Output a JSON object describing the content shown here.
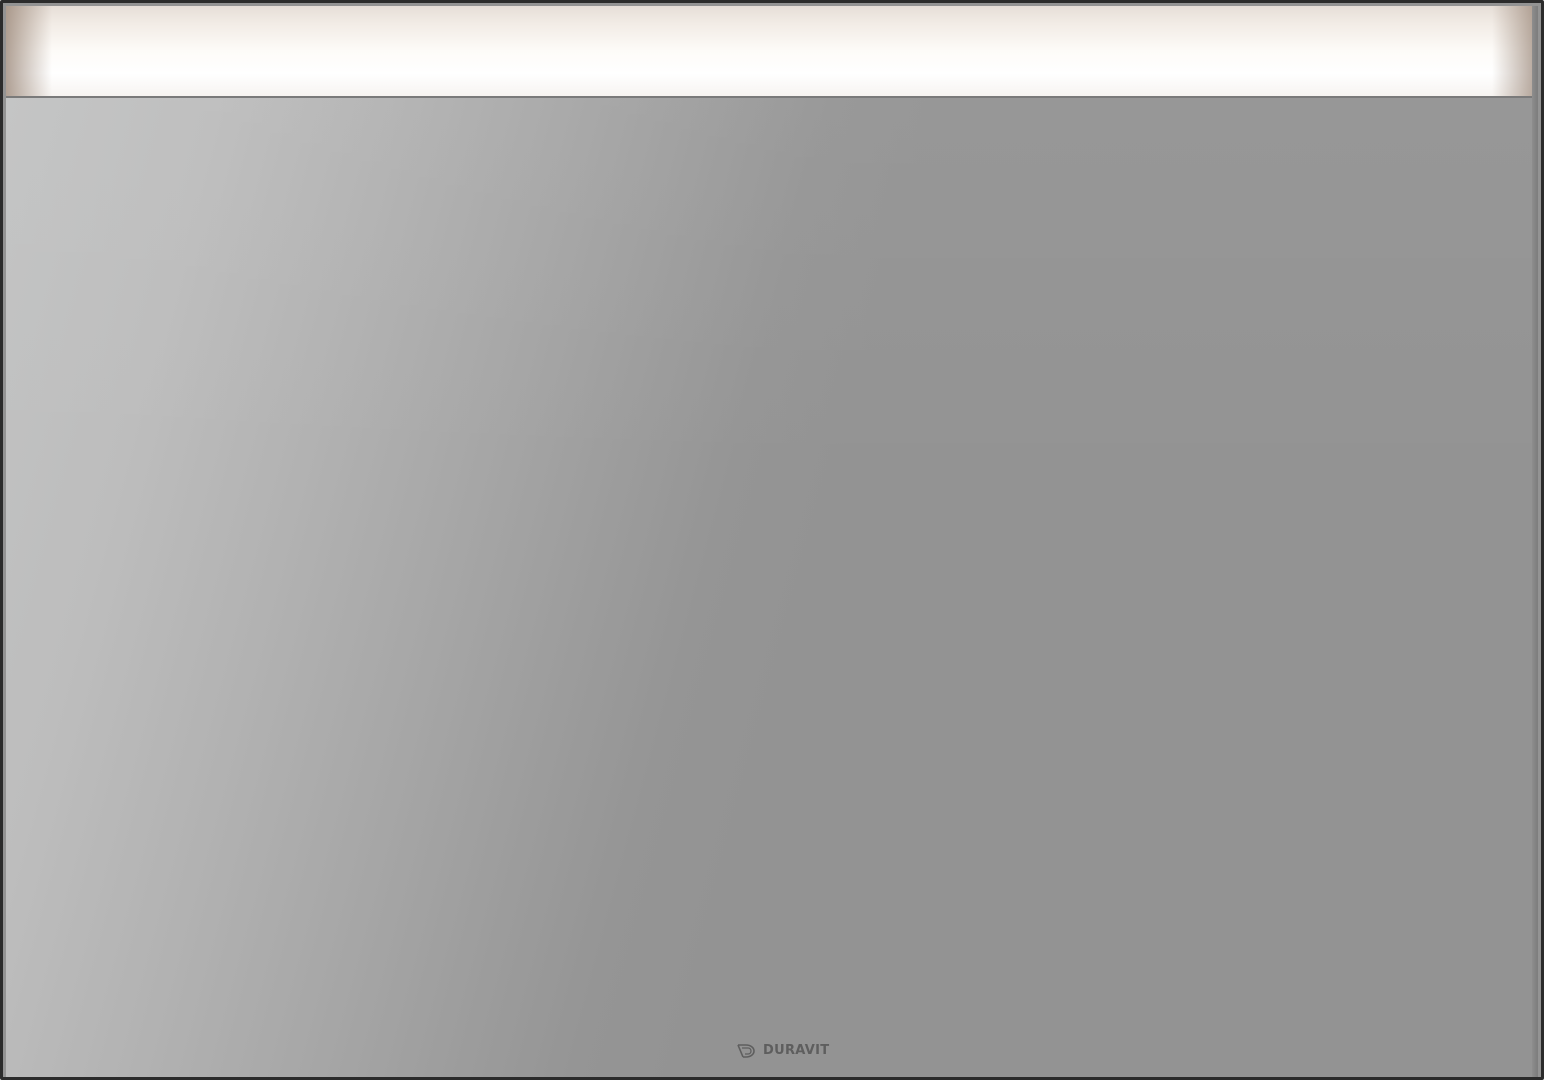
{
  "product": {
    "brand": "DURAVIT"
  },
  "colors": {
    "frame": "#2b2b2b",
    "glass": "#939393",
    "light": "#fdfbf8",
    "logo": "#5e5e5e"
  },
  "icons": {
    "logo_mark": "duravit-logo-icon"
  }
}
